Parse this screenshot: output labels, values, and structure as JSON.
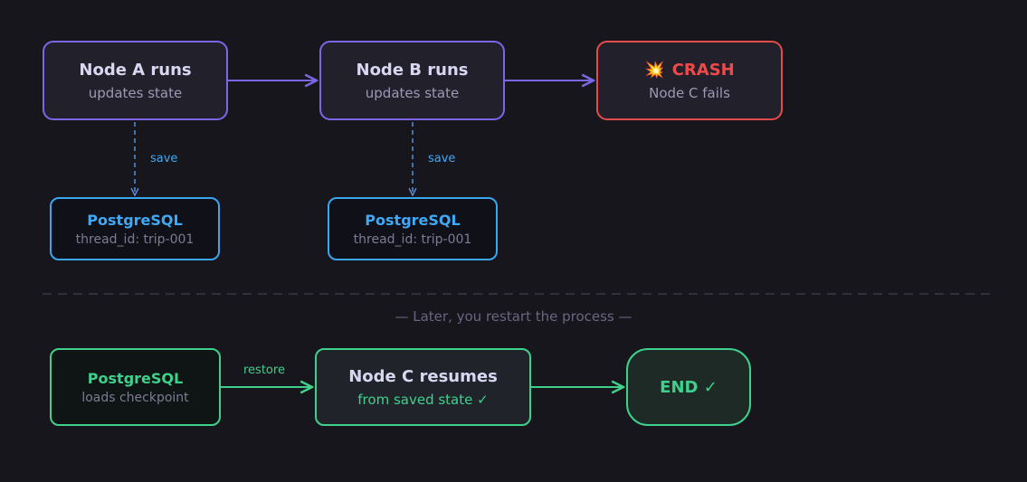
{
  "nodes": {
    "node_a": {
      "title": "Node A runs",
      "subtitle": "updates state"
    },
    "node_b": {
      "title": "Node B runs",
      "subtitle": "updates state"
    },
    "crash": {
      "icon": "explosion-icon",
      "icon_glyph": "💥",
      "title": "CRASH",
      "subtitle": "Node C fails"
    },
    "pg_a": {
      "title": "PostgreSQL",
      "subtitle": "thread_id: trip-001"
    },
    "pg_b": {
      "title": "PostgreSQL",
      "subtitle": "thread_id: trip-001"
    },
    "pg_restore": {
      "title": "PostgreSQL",
      "subtitle": "loads checkpoint"
    },
    "node_c": {
      "title": "Node C resumes",
      "subtitle": "from saved state ✓"
    },
    "end": {
      "title": "END ✓"
    }
  },
  "edge_labels": {
    "save_a": "save",
    "save_b": "save",
    "restore": "restore"
  },
  "divider": {
    "text": "— Later, you restart the process —"
  },
  "colors": {
    "background": "#16161c",
    "node_border": "#7c66e6",
    "crash_border": "#e54b4b",
    "postgres_blue": "#3aa6ef",
    "success_green": "#3fd08c",
    "divider": "#3a3845"
  }
}
